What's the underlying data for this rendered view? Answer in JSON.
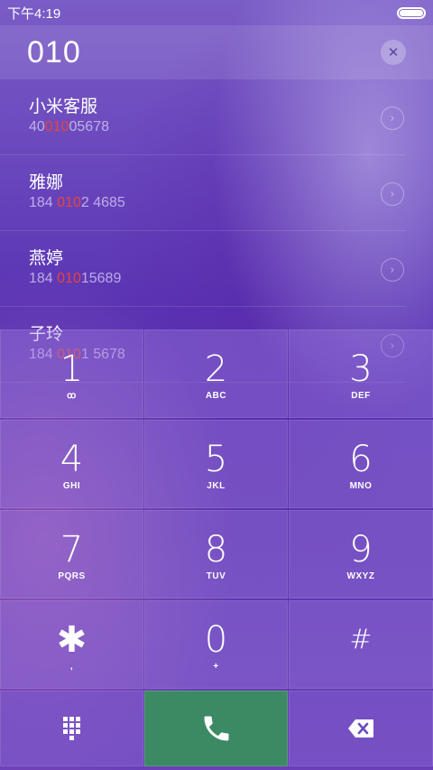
{
  "status": {
    "time": "下午4:19"
  },
  "dialer": {
    "number": "010",
    "clear_icon": "✕"
  },
  "results": [
    {
      "name": "小米客服",
      "pre": "40",
      "hit": "010",
      "post": "05678"
    },
    {
      "name": "雅娜",
      "pre": "184 ",
      "hit": "010",
      "post": "2 4685"
    },
    {
      "name": "燕婷",
      "pre": "184 ",
      "hit": "010",
      "post": "15689"
    },
    {
      "name": "子玲",
      "pre": "184 ",
      "hit": "010",
      "post": "1 5678"
    }
  ],
  "keys": [
    {
      "digit": "1",
      "letters": "ꝏ"
    },
    {
      "digit": "2",
      "letters": "ABC"
    },
    {
      "digit": "3",
      "letters": "DEF"
    },
    {
      "digit": "4",
      "letters": "GHI"
    },
    {
      "digit": "5",
      "letters": "JKL"
    },
    {
      "digit": "6",
      "letters": "MNO"
    },
    {
      "digit": "7",
      "letters": "PQRS"
    },
    {
      "digit": "8",
      "letters": "TUV"
    },
    {
      "digit": "9",
      "letters": "WXYZ"
    },
    {
      "digit": "✱",
      "letters": ","
    },
    {
      "digit": "0",
      "letters": "+"
    },
    {
      "digit": "#",
      "letters": ""
    }
  ],
  "icons": {
    "chevron": "›",
    "call": "phone-icon",
    "delete": "backspace-icon",
    "keypad": "keypad-icon"
  },
  "colors": {
    "highlight": "#e8443c",
    "call": "#3c8a63"
  }
}
